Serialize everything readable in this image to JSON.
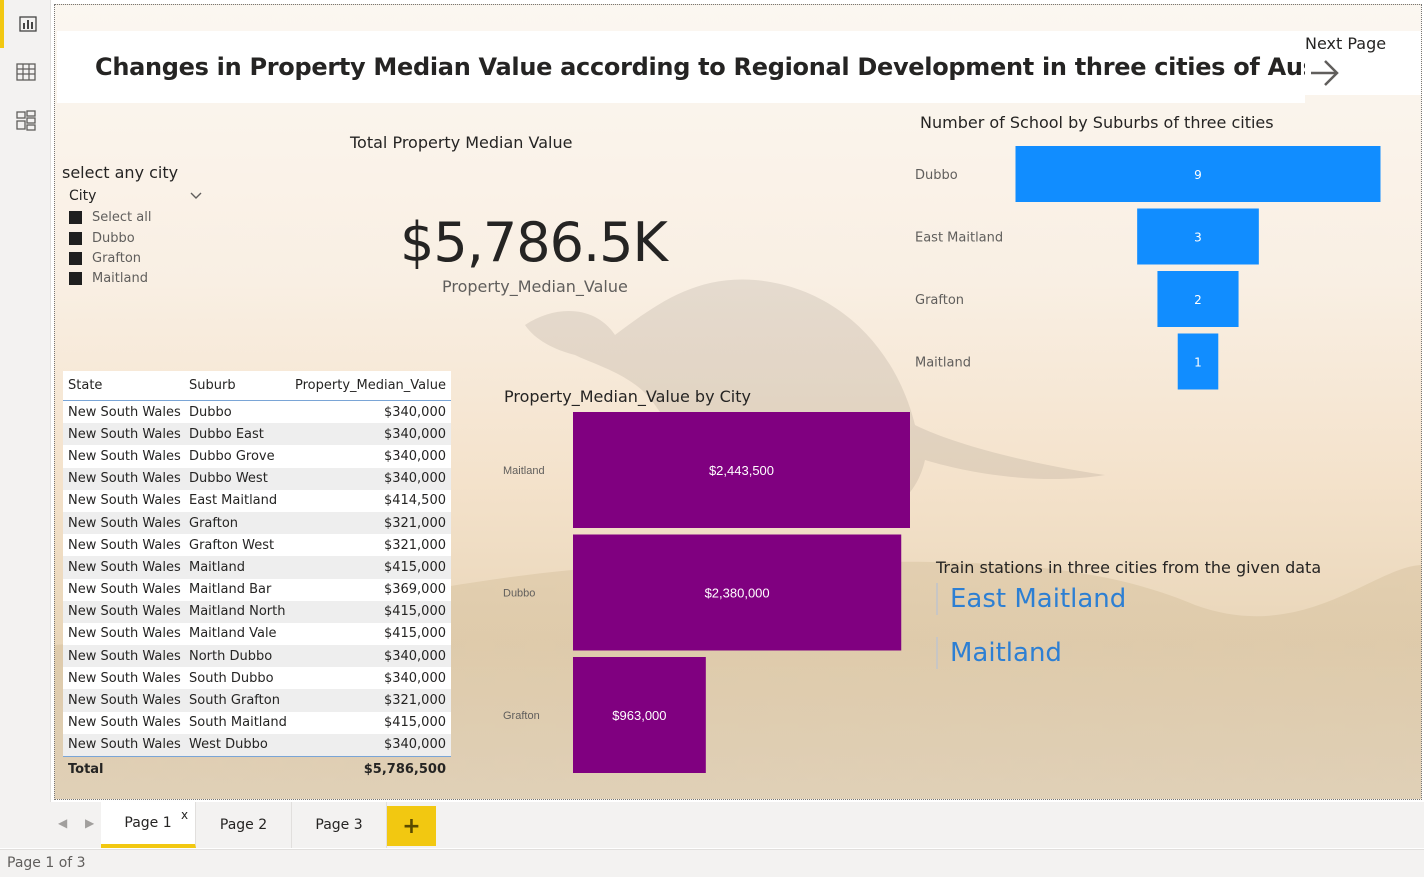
{
  "title": "Changes in Property Median Value according to Regional Development in three cities of Australia",
  "next_page": {
    "label": "Next Page",
    "icon": "arrow-right-icon"
  },
  "rail": [
    {
      "icon": "report-view-icon",
      "active": true
    },
    {
      "icon": "data-view-icon",
      "active": false
    },
    {
      "icon": "model-view-icon",
      "active": false
    }
  ],
  "slicer": {
    "title": "select any city",
    "field": "City",
    "items": [
      "Select all",
      "Dubbo",
      "Grafton",
      "Maitland"
    ]
  },
  "card": {
    "title": "Total Property Median Value",
    "value": "$5,786.5K",
    "label": "Property_Median_Value"
  },
  "table": {
    "headers": [
      "State",
      "Suburb",
      "Property_Median_Value"
    ],
    "rows": [
      [
        "New South Wales",
        "Dubbo",
        "$340,000"
      ],
      [
        "New South Wales",
        "Dubbo East",
        "$340,000"
      ],
      [
        "New South Wales",
        "Dubbo Grove",
        "$340,000"
      ],
      [
        "New South Wales",
        "Dubbo West",
        "$340,000"
      ],
      [
        "New South Wales",
        "East Maitland",
        "$414,500"
      ],
      [
        "New South Wales",
        "Grafton",
        "$321,000"
      ],
      [
        "New South Wales",
        "Grafton West",
        "$321,000"
      ],
      [
        "New South Wales",
        "Maitland",
        "$415,000"
      ],
      [
        "New South Wales",
        "Maitland Bar",
        "$369,000"
      ],
      [
        "New South Wales",
        "Maitland North",
        "$415,000"
      ],
      [
        "New South Wales",
        "Maitland Vale",
        "$415,000"
      ],
      [
        "New South Wales",
        "North Dubbo",
        "$340,000"
      ],
      [
        "New South Wales",
        "South Dubbo",
        "$340,000"
      ],
      [
        "New South Wales",
        "South Grafton",
        "$321,000"
      ],
      [
        "New South Wales",
        "South Maitland",
        "$415,000"
      ],
      [
        "New South Wales",
        "West Dubbo",
        "$340,000"
      ]
    ],
    "total_label": "Total",
    "total_value": "$5,786,500"
  },
  "chart_data": [
    {
      "type": "bar",
      "orientation": "horizontal",
      "title": "Property_Median_Value by City",
      "categories": [
        "Maitland",
        "Dubbo",
        "Grafton"
      ],
      "values": [
        2443500,
        2380000,
        963000
      ],
      "data_labels": [
        "$2,443,500",
        "$2,380,000",
        "$963,000"
      ],
      "color": "#800080",
      "xlim": [
        0,
        2443500
      ]
    },
    {
      "type": "bar",
      "orientation": "funnel",
      "title": "Number of School by Suburbs of three cities",
      "categories": [
        "Dubbo",
        "East Maitland",
        "Grafton",
        "Maitland"
      ],
      "values": [
        9,
        3,
        2,
        1
      ],
      "data_labels": [
        "9",
        "3",
        "2",
        "1"
      ],
      "color": "#118dff"
    }
  ],
  "train": {
    "title": "Train stations in three cities from the given data",
    "items": [
      "East Maitland",
      "Maitland"
    ],
    "color": "#2d7fd3"
  },
  "tabs": {
    "items": [
      "Page 1",
      "Page 2",
      "Page 3"
    ],
    "active": "Page 1",
    "close": "x",
    "add": "+"
  },
  "status": "Page 1 of 3",
  "colors": {
    "accent": "#f2c811",
    "bar_purple": "#800080",
    "bar_blue": "#118dff"
  }
}
